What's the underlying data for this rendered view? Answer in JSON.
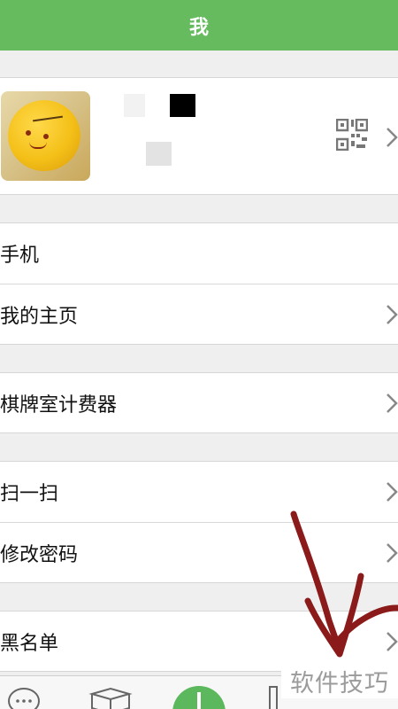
{
  "header": {
    "title": "我"
  },
  "profile": {
    "qr_icon": "qr-code-icon",
    "chevron_icon": "chevron-right-icon",
    "avatar_icon": "avatar"
  },
  "menu": {
    "phone": "手机",
    "homepage": "我的主页",
    "chess_timer": "棋牌室计费器",
    "scan": "扫一扫",
    "change_password": "修改密码",
    "blacklist": "黑名单"
  },
  "tabbar": {
    "icons": [
      "chat-bubble-icon",
      "box-icon",
      "add-icon",
      "tab-icon"
    ]
  },
  "watermark": {
    "text": "软件技巧"
  },
  "colors": {
    "header": "#66bb5e",
    "accent": "#5cb85c",
    "annotation": "#8b1a1a"
  }
}
